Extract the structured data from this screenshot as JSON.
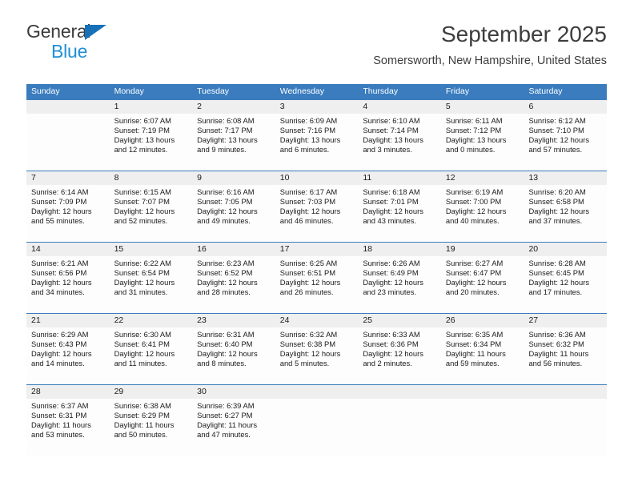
{
  "brand": {
    "line1": "General",
    "line2": "Blue",
    "triangle_color": "#1771b8",
    "blue_text_color": "#1f8fd6"
  },
  "header": {
    "title": "September 2025",
    "location": "Somersworth, New Hampshire, United States"
  },
  "theme": {
    "header_blue": "#3a7cbe",
    "daynum_band": "#efefef",
    "cell_bg": "#fdfdfd"
  },
  "weekdays": [
    "Sunday",
    "Monday",
    "Tuesday",
    "Wednesday",
    "Thursday",
    "Friday",
    "Saturday"
  ],
  "weeks": [
    [
      {
        "day": "",
        "l1": "",
        "l2": "",
        "l3": "",
        "l4": ""
      },
      {
        "day": "1",
        "l1": "Sunrise: 6:07 AM",
        "l2": "Sunset: 7:19 PM",
        "l3": "Daylight: 13 hours",
        "l4": "and 12 minutes."
      },
      {
        "day": "2",
        "l1": "Sunrise: 6:08 AM",
        "l2": "Sunset: 7:17 PM",
        "l3": "Daylight: 13 hours",
        "l4": "and 9 minutes."
      },
      {
        "day": "3",
        "l1": "Sunrise: 6:09 AM",
        "l2": "Sunset: 7:16 PM",
        "l3": "Daylight: 13 hours",
        "l4": "and 6 minutes."
      },
      {
        "day": "4",
        "l1": "Sunrise: 6:10 AM",
        "l2": "Sunset: 7:14 PM",
        "l3": "Daylight: 13 hours",
        "l4": "and 3 minutes."
      },
      {
        "day": "5",
        "l1": "Sunrise: 6:11 AM",
        "l2": "Sunset: 7:12 PM",
        "l3": "Daylight: 13 hours",
        "l4": "and 0 minutes."
      },
      {
        "day": "6",
        "l1": "Sunrise: 6:12 AM",
        "l2": "Sunset: 7:10 PM",
        "l3": "Daylight: 12 hours",
        "l4": "and 57 minutes."
      }
    ],
    [
      {
        "day": "7",
        "l1": "Sunrise: 6:14 AM",
        "l2": "Sunset: 7:09 PM",
        "l3": "Daylight: 12 hours",
        "l4": "and 55 minutes."
      },
      {
        "day": "8",
        "l1": "Sunrise: 6:15 AM",
        "l2": "Sunset: 7:07 PM",
        "l3": "Daylight: 12 hours",
        "l4": "and 52 minutes."
      },
      {
        "day": "9",
        "l1": "Sunrise: 6:16 AM",
        "l2": "Sunset: 7:05 PM",
        "l3": "Daylight: 12 hours",
        "l4": "and 49 minutes."
      },
      {
        "day": "10",
        "l1": "Sunrise: 6:17 AM",
        "l2": "Sunset: 7:03 PM",
        "l3": "Daylight: 12 hours",
        "l4": "and 46 minutes."
      },
      {
        "day": "11",
        "l1": "Sunrise: 6:18 AM",
        "l2": "Sunset: 7:01 PM",
        "l3": "Daylight: 12 hours",
        "l4": "and 43 minutes."
      },
      {
        "day": "12",
        "l1": "Sunrise: 6:19 AM",
        "l2": "Sunset: 7:00 PM",
        "l3": "Daylight: 12 hours",
        "l4": "and 40 minutes."
      },
      {
        "day": "13",
        "l1": "Sunrise: 6:20 AM",
        "l2": "Sunset: 6:58 PM",
        "l3": "Daylight: 12 hours",
        "l4": "and 37 minutes."
      }
    ],
    [
      {
        "day": "14",
        "l1": "Sunrise: 6:21 AM",
        "l2": "Sunset: 6:56 PM",
        "l3": "Daylight: 12 hours",
        "l4": "and 34 minutes."
      },
      {
        "day": "15",
        "l1": "Sunrise: 6:22 AM",
        "l2": "Sunset: 6:54 PM",
        "l3": "Daylight: 12 hours",
        "l4": "and 31 minutes."
      },
      {
        "day": "16",
        "l1": "Sunrise: 6:23 AM",
        "l2": "Sunset: 6:52 PM",
        "l3": "Daylight: 12 hours",
        "l4": "and 28 minutes."
      },
      {
        "day": "17",
        "l1": "Sunrise: 6:25 AM",
        "l2": "Sunset: 6:51 PM",
        "l3": "Daylight: 12 hours",
        "l4": "and 26 minutes."
      },
      {
        "day": "18",
        "l1": "Sunrise: 6:26 AM",
        "l2": "Sunset: 6:49 PM",
        "l3": "Daylight: 12 hours",
        "l4": "and 23 minutes."
      },
      {
        "day": "19",
        "l1": "Sunrise: 6:27 AM",
        "l2": "Sunset: 6:47 PM",
        "l3": "Daylight: 12 hours",
        "l4": "and 20 minutes."
      },
      {
        "day": "20",
        "l1": "Sunrise: 6:28 AM",
        "l2": "Sunset: 6:45 PM",
        "l3": "Daylight: 12 hours",
        "l4": "and 17 minutes."
      }
    ],
    [
      {
        "day": "21",
        "l1": "Sunrise: 6:29 AM",
        "l2": "Sunset: 6:43 PM",
        "l3": "Daylight: 12 hours",
        "l4": "and 14 minutes."
      },
      {
        "day": "22",
        "l1": "Sunrise: 6:30 AM",
        "l2": "Sunset: 6:41 PM",
        "l3": "Daylight: 12 hours",
        "l4": "and 11 minutes."
      },
      {
        "day": "23",
        "l1": "Sunrise: 6:31 AM",
        "l2": "Sunset: 6:40 PM",
        "l3": "Daylight: 12 hours",
        "l4": "and 8 minutes."
      },
      {
        "day": "24",
        "l1": "Sunrise: 6:32 AM",
        "l2": "Sunset: 6:38 PM",
        "l3": "Daylight: 12 hours",
        "l4": "and 5 minutes."
      },
      {
        "day": "25",
        "l1": "Sunrise: 6:33 AM",
        "l2": "Sunset: 6:36 PM",
        "l3": "Daylight: 12 hours",
        "l4": "and 2 minutes."
      },
      {
        "day": "26",
        "l1": "Sunrise: 6:35 AM",
        "l2": "Sunset: 6:34 PM",
        "l3": "Daylight: 11 hours",
        "l4": "and 59 minutes."
      },
      {
        "day": "27",
        "l1": "Sunrise: 6:36 AM",
        "l2": "Sunset: 6:32 PM",
        "l3": "Daylight: 11 hours",
        "l4": "and 56 minutes."
      }
    ],
    [
      {
        "day": "28",
        "l1": "Sunrise: 6:37 AM",
        "l2": "Sunset: 6:31 PM",
        "l3": "Daylight: 11 hours",
        "l4": "and 53 minutes."
      },
      {
        "day": "29",
        "l1": "Sunrise: 6:38 AM",
        "l2": "Sunset: 6:29 PM",
        "l3": "Daylight: 11 hours",
        "l4": "and 50 minutes."
      },
      {
        "day": "30",
        "l1": "Sunrise: 6:39 AM",
        "l2": "Sunset: 6:27 PM",
        "l3": "Daylight: 11 hours",
        "l4": "and 47 minutes."
      },
      {
        "day": "",
        "l1": "",
        "l2": "",
        "l3": "",
        "l4": ""
      },
      {
        "day": "",
        "l1": "",
        "l2": "",
        "l3": "",
        "l4": ""
      },
      {
        "day": "",
        "l1": "",
        "l2": "",
        "l3": "",
        "l4": ""
      },
      {
        "day": "",
        "l1": "",
        "l2": "",
        "l3": "",
        "l4": ""
      }
    ]
  ]
}
